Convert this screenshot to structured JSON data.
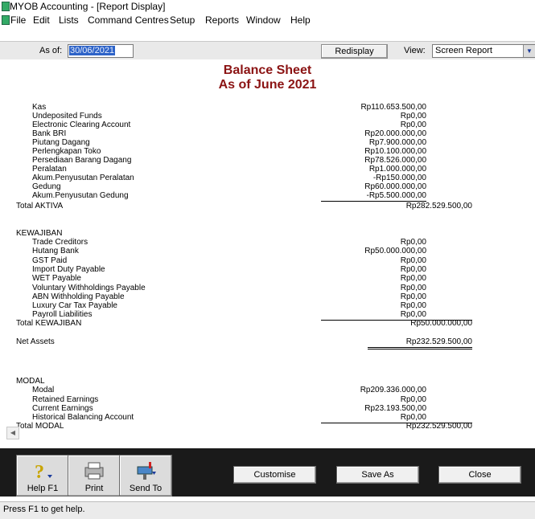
{
  "window": {
    "title": "MYOB Accounting - [Report Display]"
  },
  "menu": [
    "File",
    "Edit",
    "Lists",
    "Command Centres",
    "Setup",
    "Reports",
    "Window",
    "Help"
  ],
  "toolbar": {
    "as_of_label": "As of:",
    "as_of_value": "30/06/2021",
    "redisplay_label": "Redisplay",
    "view_label": "View:",
    "view_value": "Screen Report"
  },
  "report": {
    "title": "Balance Sheet",
    "subtitle": "As of June 2021",
    "aktiva": [
      {
        "label": "Kas",
        "amount": "Rp110.653.500,00"
      },
      {
        "label": "Undeposited Funds",
        "amount": "Rp0,00"
      },
      {
        "label": "Electronic Clearing Account",
        "amount": "Rp0,00"
      },
      {
        "label": "Bank BRI",
        "amount": "Rp20.000.000,00"
      },
      {
        "label": "Piutang Dagang",
        "amount": "Rp7.900.000,00"
      },
      {
        "label": "Perlengkapan Toko",
        "amount": "Rp10.100.000,00"
      },
      {
        "label": "Persediaan Barang Dagang",
        "amount": "Rp78.526.000,00"
      },
      {
        "label": "Peralatan",
        "amount": "Rp1.000.000,00"
      },
      {
        "label": "Akum.Penyusutan Peralatan",
        "amount": "-Rp150.000,00"
      },
      {
        "label": "Gedung",
        "amount": "Rp60.000.000,00"
      },
      {
        "label": "Akum.Penyusutan Gedung",
        "amount": "-Rp5.500.000,00"
      }
    ],
    "total_aktiva": {
      "label": "Total AKTIVA",
      "amount": "Rp282.529.500,00"
    },
    "kewajiban_header": "KEWAJIBAN",
    "kewajiban": [
      {
        "label": "Trade Creditors",
        "amount": "Rp0,00"
      },
      {
        "label": "Hutang Bank",
        "amount": "Rp50.000.000,00"
      },
      {
        "label": "GST Paid",
        "amount": "Rp0,00"
      },
      {
        "label": "Import Duty Payable",
        "amount": "Rp0,00"
      },
      {
        "label": "WET Payable",
        "amount": "Rp0,00"
      },
      {
        "label": "Voluntary Withholdings Payable",
        "amount": "Rp0,00"
      },
      {
        "label": "ABN Withholding Payable",
        "amount": "Rp0,00"
      },
      {
        "label": "Luxury Car Tax Payable",
        "amount": "Rp0,00"
      },
      {
        "label": "Payroll Liabilities",
        "amount": "Rp0,00"
      }
    ],
    "total_kewajiban": {
      "label": "Total KEWAJIBAN",
      "amount": "Rp50.000.000,00"
    },
    "net_assets": {
      "label": "Net Assets",
      "amount": "Rp232.529.500,00"
    },
    "modal_header": "MODAL",
    "modal": [
      {
        "label": "Modal",
        "amount": "Rp209.336.000,00"
      },
      {
        "label": "Retained Earnings",
        "amount": "Rp0,00"
      },
      {
        "label": "Current Earnings",
        "amount": "Rp23.193.500,00"
      },
      {
        "label": "Historical Balancing Account",
        "amount": "Rp0,00"
      }
    ],
    "total_modal": {
      "label": "Total MODAL",
      "amount": "Rp232.529.500,00"
    }
  },
  "bottom": {
    "help": "Help F1",
    "print": "Print",
    "send_to": "Send To",
    "customise": "Customise",
    "save_as": "Save As",
    "close": "Close"
  },
  "status": "Press F1 to get help."
}
